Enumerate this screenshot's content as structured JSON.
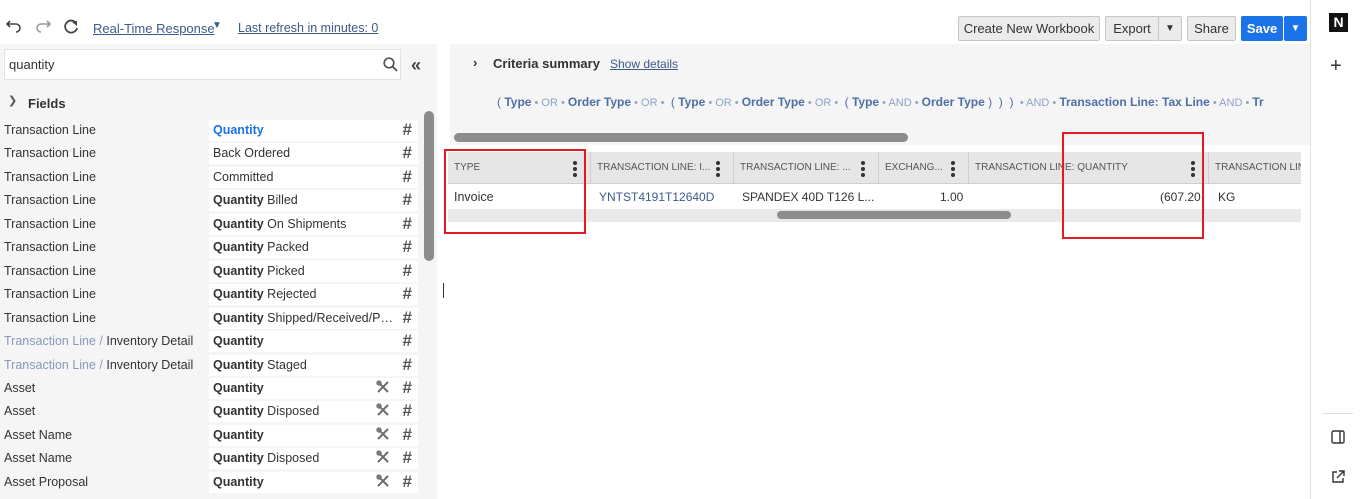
{
  "toolbar": {
    "mode_label": "Real-Time Response",
    "refresh_label": "Last refresh in minutes: 0",
    "create_workbook": "Create New Workbook",
    "export": "Export",
    "share": "Share",
    "save": "Save"
  },
  "search": {
    "value": "quantity"
  },
  "fields": {
    "header": "Fields",
    "rows": [
      {
        "record": "Transaction Line",
        "record_muted": "",
        "bold": "Quantity",
        "rest": "",
        "selected": true,
        "tool": false
      },
      {
        "record": "Transaction Line",
        "record_muted": "",
        "bold": "",
        "rest": "Back Ordered",
        "selected": false,
        "tool": false
      },
      {
        "record": "Transaction Line",
        "record_muted": "",
        "bold": "",
        "rest": "Committed",
        "selected": false,
        "tool": false
      },
      {
        "record": "Transaction Line",
        "record_muted": "",
        "bold": "Quantity",
        "rest": " Billed",
        "selected": false,
        "tool": false
      },
      {
        "record": "Transaction Line",
        "record_muted": "",
        "bold": "Quantity",
        "rest": " On Shipments",
        "selected": false,
        "tool": false
      },
      {
        "record": "Transaction Line",
        "record_muted": "",
        "bold": "Quantity",
        "rest": " Packed",
        "selected": false,
        "tool": false
      },
      {
        "record": "Transaction Line",
        "record_muted": "",
        "bold": "Quantity",
        "rest": " Picked",
        "selected": false,
        "tool": false
      },
      {
        "record": "Transaction Line",
        "record_muted": "",
        "bold": "Quantity",
        "rest": " Rejected",
        "selected": false,
        "tool": false
      },
      {
        "record": "Transaction Line",
        "record_muted": "",
        "bold": "Quantity",
        "rest": " Shipped/Received/Pi...",
        "selected": false,
        "tool": false
      },
      {
        "record": "Inventory Detail",
        "record_muted": "Transaction Line / ",
        "bold": "Quantity",
        "rest": "",
        "selected": false,
        "tool": false
      },
      {
        "record": "Inventory Detail",
        "record_muted": "Transaction Line / ",
        "bold": "Quantity",
        "rest": " Staged",
        "selected": false,
        "tool": false
      },
      {
        "record": "Asset",
        "record_muted": "",
        "bold": "Quantity",
        "rest": "",
        "selected": false,
        "tool": true
      },
      {
        "record": "Asset",
        "record_muted": "",
        "bold": "Quantity",
        "rest": " Disposed",
        "selected": false,
        "tool": true
      },
      {
        "record": "Asset Name",
        "record_muted": "",
        "bold": "Quantity",
        "rest": "",
        "selected": false,
        "tool": true
      },
      {
        "record": "Asset Name",
        "record_muted": "",
        "bold": "Quantity",
        "rest": " Disposed",
        "selected": false,
        "tool": true
      },
      {
        "record": "Asset Proposal",
        "record_muted": "",
        "bold": "Quantity",
        "rest": "",
        "selected": false,
        "tool": true
      }
    ]
  },
  "criteria": {
    "title": "Criteria summary",
    "show_details": "Show details",
    "segments": [
      {
        "t": "( ",
        "k": "p"
      },
      {
        "t": "Type",
        "k": "b"
      },
      {
        "t": " • OR • ",
        "k": "o"
      },
      {
        "t": "Order Type",
        "k": "b"
      },
      {
        "t": " • OR • ",
        "k": "o"
      },
      {
        "t": " ( ",
        "k": "p"
      },
      {
        "t": "Type",
        "k": "b"
      },
      {
        "t": " • OR • ",
        "k": "o"
      },
      {
        "t": "Order Type",
        "k": "b"
      },
      {
        "t": " • OR • ",
        "k": "o"
      },
      {
        "t": " ( ",
        "k": "p"
      },
      {
        "t": "Type",
        "k": "b"
      },
      {
        "t": " • AND • ",
        "k": "o"
      },
      {
        "t": "Order Type",
        "k": "b"
      },
      {
        "t": " )  )  ) ",
        "k": "p"
      },
      {
        "t": " • AND • ",
        "k": "o"
      },
      {
        "t": "Transaction Line: Tax Line",
        "k": "b"
      },
      {
        "t": " • AND • ",
        "k": "o"
      },
      {
        "t": "Tr",
        "k": "b"
      }
    ]
  },
  "grid": {
    "columns": [
      "TYPE",
      "TRANSACTION LINE: I...",
      "TRANSACTION LINE: ...",
      "EXCHANG...",
      "TRANSACTION LINE: QUANTITY",
      "TRANSACTION LIN"
    ],
    "row": [
      "Invoice",
      "YNTST4191T12640D",
      "SPANDEX 40D T126 L...",
      "1.00",
      "(607.20",
      "KG"
    ]
  },
  "colors": {
    "accent": "#1a73e8",
    "highlight_box": "#e01b24",
    "link": "#3c5a8c"
  },
  "icons": [
    "undo-icon",
    "redo-icon",
    "refresh-icon",
    "search-icon",
    "collapse-icon",
    "hash-icon",
    "wrench-icon",
    "netsuite-logo",
    "plus-icon",
    "panel-icon",
    "external-link-icon"
  ]
}
